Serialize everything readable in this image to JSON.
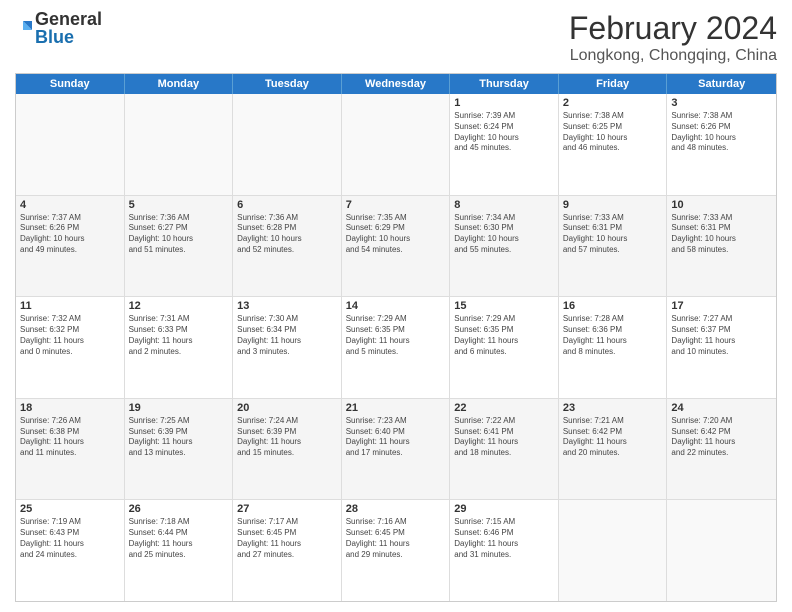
{
  "logo": {
    "general": "General",
    "blue": "Blue"
  },
  "title": "February 2024",
  "subtitle": "Longkong, Chongqing, China",
  "days": [
    "Sunday",
    "Monday",
    "Tuesday",
    "Wednesday",
    "Thursday",
    "Friday",
    "Saturday"
  ],
  "rows": [
    [
      {
        "num": "",
        "info": "",
        "empty": true
      },
      {
        "num": "",
        "info": "",
        "empty": true
      },
      {
        "num": "",
        "info": "",
        "empty": true
      },
      {
        "num": "",
        "info": "",
        "empty": true
      },
      {
        "num": "1",
        "info": "Sunrise: 7:39 AM\nSunset: 6:24 PM\nDaylight: 10 hours\nand 45 minutes."
      },
      {
        "num": "2",
        "info": "Sunrise: 7:38 AM\nSunset: 6:25 PM\nDaylight: 10 hours\nand 46 minutes."
      },
      {
        "num": "3",
        "info": "Sunrise: 7:38 AM\nSunset: 6:26 PM\nDaylight: 10 hours\nand 48 minutes."
      }
    ],
    [
      {
        "num": "4",
        "info": "Sunrise: 7:37 AM\nSunset: 6:26 PM\nDaylight: 10 hours\nand 49 minutes."
      },
      {
        "num": "5",
        "info": "Sunrise: 7:36 AM\nSunset: 6:27 PM\nDaylight: 10 hours\nand 51 minutes."
      },
      {
        "num": "6",
        "info": "Sunrise: 7:36 AM\nSunset: 6:28 PM\nDaylight: 10 hours\nand 52 minutes."
      },
      {
        "num": "7",
        "info": "Sunrise: 7:35 AM\nSunset: 6:29 PM\nDaylight: 10 hours\nand 54 minutes."
      },
      {
        "num": "8",
        "info": "Sunrise: 7:34 AM\nSunset: 6:30 PM\nDaylight: 10 hours\nand 55 minutes."
      },
      {
        "num": "9",
        "info": "Sunrise: 7:33 AM\nSunset: 6:31 PM\nDaylight: 10 hours\nand 57 minutes."
      },
      {
        "num": "10",
        "info": "Sunrise: 7:33 AM\nSunset: 6:31 PM\nDaylight: 10 hours\nand 58 minutes."
      }
    ],
    [
      {
        "num": "11",
        "info": "Sunrise: 7:32 AM\nSunset: 6:32 PM\nDaylight: 11 hours\nand 0 minutes."
      },
      {
        "num": "12",
        "info": "Sunrise: 7:31 AM\nSunset: 6:33 PM\nDaylight: 11 hours\nand 2 minutes."
      },
      {
        "num": "13",
        "info": "Sunrise: 7:30 AM\nSunset: 6:34 PM\nDaylight: 11 hours\nand 3 minutes."
      },
      {
        "num": "14",
        "info": "Sunrise: 7:29 AM\nSunset: 6:35 PM\nDaylight: 11 hours\nand 5 minutes."
      },
      {
        "num": "15",
        "info": "Sunrise: 7:29 AM\nSunset: 6:35 PM\nDaylight: 11 hours\nand 6 minutes."
      },
      {
        "num": "16",
        "info": "Sunrise: 7:28 AM\nSunset: 6:36 PM\nDaylight: 11 hours\nand 8 minutes."
      },
      {
        "num": "17",
        "info": "Sunrise: 7:27 AM\nSunset: 6:37 PM\nDaylight: 11 hours\nand 10 minutes."
      }
    ],
    [
      {
        "num": "18",
        "info": "Sunrise: 7:26 AM\nSunset: 6:38 PM\nDaylight: 11 hours\nand 11 minutes."
      },
      {
        "num": "19",
        "info": "Sunrise: 7:25 AM\nSunset: 6:39 PM\nDaylight: 11 hours\nand 13 minutes."
      },
      {
        "num": "20",
        "info": "Sunrise: 7:24 AM\nSunset: 6:39 PM\nDaylight: 11 hours\nand 15 minutes."
      },
      {
        "num": "21",
        "info": "Sunrise: 7:23 AM\nSunset: 6:40 PM\nDaylight: 11 hours\nand 17 minutes."
      },
      {
        "num": "22",
        "info": "Sunrise: 7:22 AM\nSunset: 6:41 PM\nDaylight: 11 hours\nand 18 minutes."
      },
      {
        "num": "23",
        "info": "Sunrise: 7:21 AM\nSunset: 6:42 PM\nDaylight: 11 hours\nand 20 minutes."
      },
      {
        "num": "24",
        "info": "Sunrise: 7:20 AM\nSunset: 6:42 PM\nDaylight: 11 hours\nand 22 minutes."
      }
    ],
    [
      {
        "num": "25",
        "info": "Sunrise: 7:19 AM\nSunset: 6:43 PM\nDaylight: 11 hours\nand 24 minutes."
      },
      {
        "num": "26",
        "info": "Sunrise: 7:18 AM\nSunset: 6:44 PM\nDaylight: 11 hours\nand 25 minutes."
      },
      {
        "num": "27",
        "info": "Sunrise: 7:17 AM\nSunset: 6:45 PM\nDaylight: 11 hours\nand 27 minutes."
      },
      {
        "num": "28",
        "info": "Sunrise: 7:16 AM\nSunset: 6:45 PM\nDaylight: 11 hours\nand 29 minutes."
      },
      {
        "num": "29",
        "info": "Sunrise: 7:15 AM\nSunset: 6:46 PM\nDaylight: 11 hours\nand 31 minutes."
      },
      {
        "num": "",
        "info": "",
        "empty": true
      },
      {
        "num": "",
        "info": "",
        "empty": true
      }
    ]
  ]
}
